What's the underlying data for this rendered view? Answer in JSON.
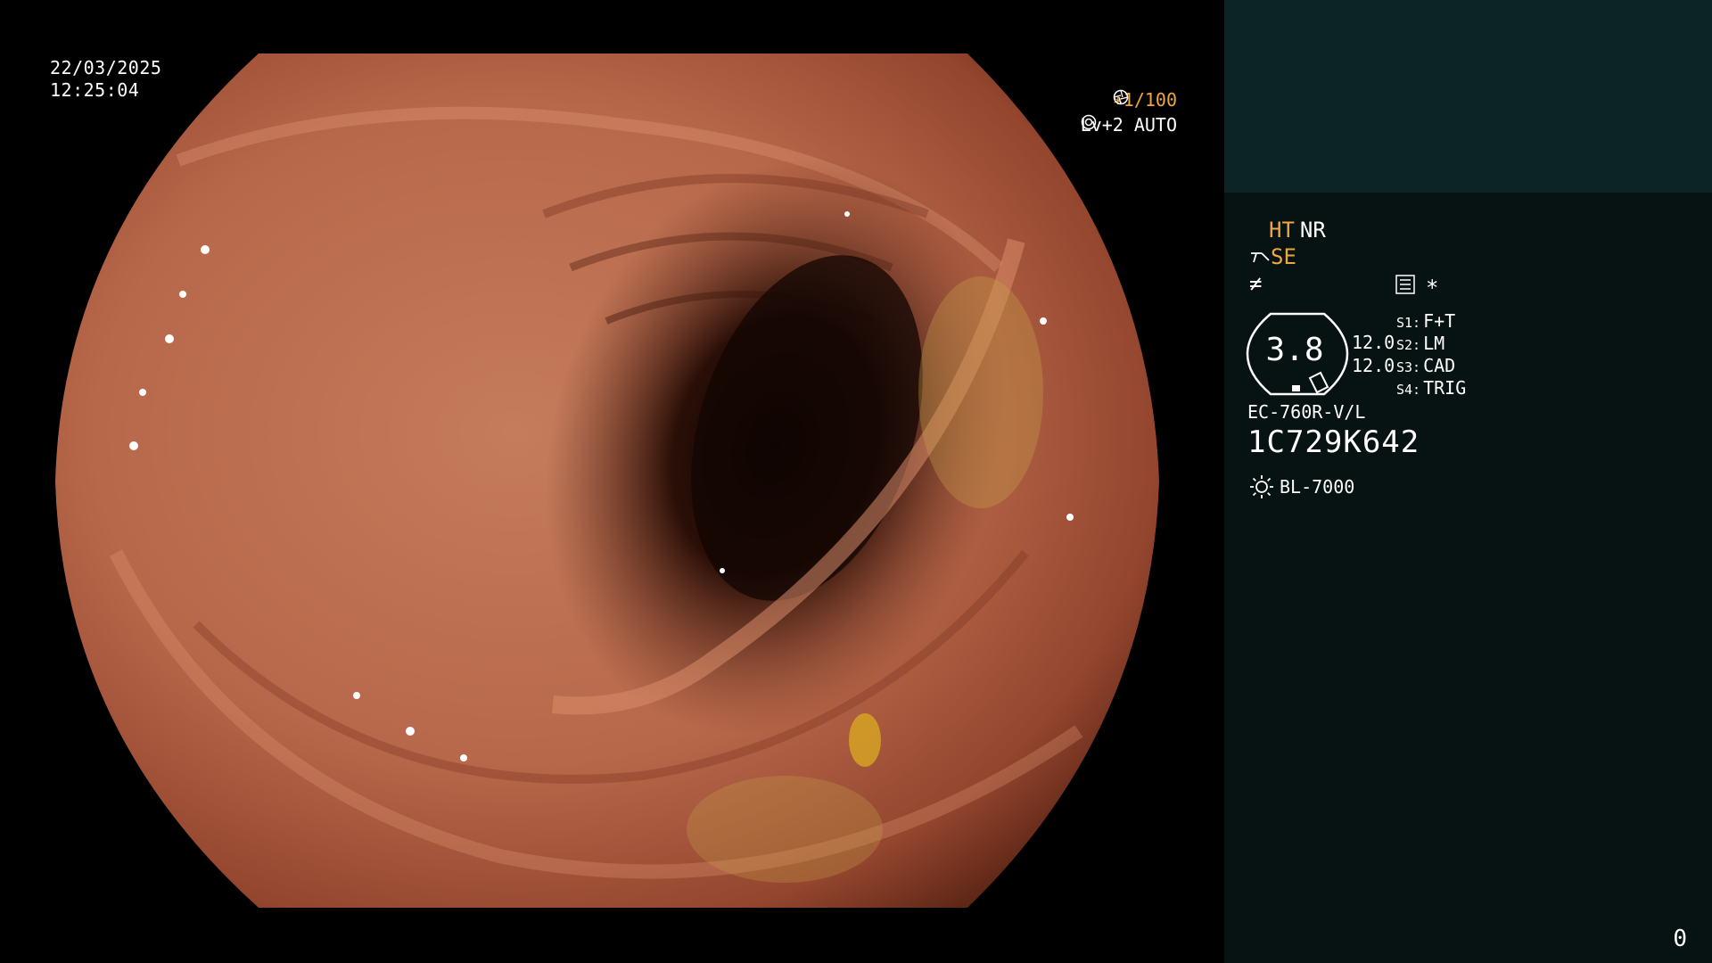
{
  "overlay": {
    "date": "22/03/2025",
    "time": "12:25:04",
    "shutter": "∗1/100",
    "level": "Lv+2 AUTO"
  },
  "panel": {
    "ht": "HT",
    "nr": "NR",
    "se": "SE",
    "edge_symbol": "≠",
    "star": "∗",
    "zoom": "3.8",
    "range_a": "12.0",
    "range_b": "12.0",
    "switches": [
      {
        "key": "S1:",
        "value": "F+T"
      },
      {
        "key": "S2:",
        "value": "LM"
      },
      {
        "key": "S3:",
        "value": "CAD"
      },
      {
        "key": "S4:",
        "value": "TRIG"
      }
    ],
    "scope_model": "EC-760R-V/L",
    "scope_serial": "1C729K642",
    "light_source": "BL-7000",
    "counter": "0"
  },
  "colors": {
    "accent": "#f0a640",
    "panel_bg": "#071212",
    "panel_top": "#0c2424",
    "tissue": "#b86a4c"
  },
  "icons": {
    "shutter": "aperture-icon",
    "level": "iris-icon",
    "se": "enhance-icon",
    "menu": "menu-list-icon",
    "light": "sun-icon"
  }
}
